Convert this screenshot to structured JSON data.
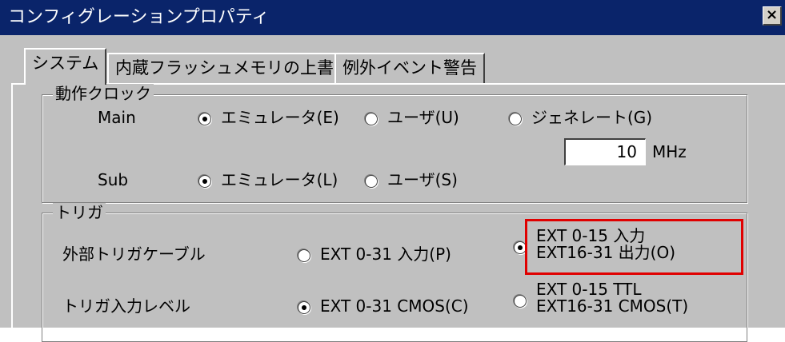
{
  "window": {
    "title": "コンフィグレーションプロパティ",
    "close_glyph": "×"
  },
  "tabs": [
    {
      "label": "システム",
      "active": true
    },
    {
      "label": "内蔵フラッシュメモリの上書き",
      "active": false
    },
    {
      "label": "例外イベント警告",
      "active": false
    }
  ],
  "clock": {
    "group_label": "動作クロック",
    "main_label": "Main",
    "main_options": [
      "エミュレータ(E)",
      "ユーザ(U)",
      "ジェネレート(G)"
    ],
    "main_selected": "エミュレータ(E)",
    "freq_value": "10",
    "freq_unit": "MHz",
    "sub_label": "Sub",
    "sub_options": [
      "エミュレータ(L)",
      "ユーザ(S)"
    ],
    "sub_selected": "エミュレータ(L)"
  },
  "trigger": {
    "group_label": "トリガ",
    "cable_label": "外部トリガケーブル",
    "cable_opt1": "EXT 0-31  入力(P)",
    "cable_opt2_line1": "EXT 0-15  入力",
    "cable_opt2_line2": "EXT16-31  出力(O)",
    "cable_selected": "EXT 0-15 入力 / EXT16-31 出力(O)",
    "level_label": "トリガ入力レベル",
    "level_opt1": "EXT 0-31  CMOS(C)",
    "level_opt2_line1": "EXT 0-15  TTL",
    "level_opt2_line2": "EXT16-31  CMOS(T)",
    "level_selected": "EXT 0-31  CMOS(C)"
  },
  "colors": {
    "title_bg": "#0a246a",
    "face": "#c0c0c0",
    "highlight_box": "#e00000"
  }
}
